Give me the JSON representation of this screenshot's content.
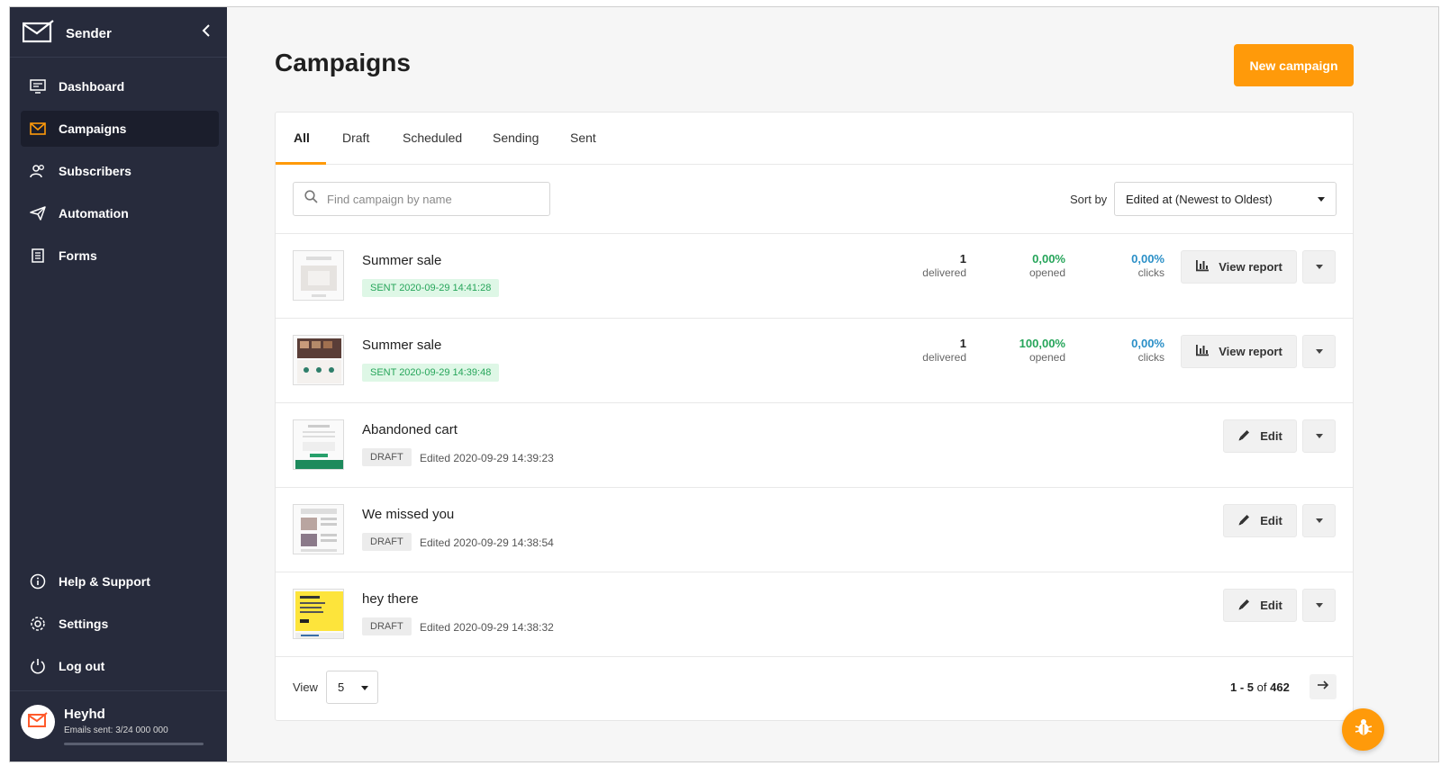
{
  "colors": {
    "accent": "#ff9a0a",
    "sidebar": "#272b3c",
    "sent_green": "#26a55a",
    "clicks_blue": "#2a8fc7"
  },
  "sidebar": {
    "brand": "Sender",
    "items": [
      {
        "label": "Dashboard",
        "icon": "dashboard-icon"
      },
      {
        "label": "Campaigns",
        "icon": "envelope-icon",
        "active": true
      },
      {
        "label": "Subscribers",
        "icon": "users-icon"
      },
      {
        "label": "Automation",
        "icon": "paper-plane-icon"
      },
      {
        "label": "Forms",
        "icon": "form-icon"
      }
    ],
    "bottom_items": [
      {
        "label": "Help & Support",
        "icon": "info-icon"
      },
      {
        "label": "Settings",
        "icon": "gear-icon"
      },
      {
        "label": "Log out",
        "icon": "power-icon"
      }
    ],
    "user": {
      "name": "Heyhd",
      "emails_sent": "Emails sent: 3/24 000 000",
      "usage_fraction": 1e-07
    }
  },
  "header": {
    "title": "Campaigns",
    "new_button": "New campaign"
  },
  "tabs": [
    "All",
    "Draft",
    "Scheduled",
    "Sending",
    "Sent"
  ],
  "search": {
    "placeholder": "Find campaign by name"
  },
  "sort": {
    "label": "Sort by",
    "value": "Edited at (Newest to Oldest)"
  },
  "campaigns": [
    {
      "name": "Summer sale",
      "status": "SENT 2020-09-29 14:41:28",
      "delivered": "1",
      "delivered_label": "delivered",
      "opened": "0,00%",
      "opened_label": "opened",
      "clicks": "0,00%",
      "clicks_label": "clicks",
      "action": "View report"
    },
    {
      "name": "Summer sale",
      "status": "SENT 2020-09-29 14:39:48",
      "delivered": "1",
      "delivered_label": "delivered",
      "opened": "100,00%",
      "opened_label": "opened",
      "clicks": "0,00%",
      "clicks_label": "clicks",
      "action": "View report"
    },
    {
      "name": "Abandoned cart",
      "status": "DRAFT",
      "edited": "Edited 2020-09-29 14:39:23",
      "action": "Edit"
    },
    {
      "name": "We missed you",
      "status": "DRAFT",
      "edited": "Edited 2020-09-29 14:38:54",
      "action": "Edit"
    },
    {
      "name": "hey there",
      "status": "DRAFT",
      "edited": "Edited 2020-09-29 14:38:32",
      "action": "Edit"
    }
  ],
  "footer": {
    "view_label": "View",
    "page_size": "5",
    "range": "1 - 5",
    "of_label": "of",
    "total": "462"
  }
}
